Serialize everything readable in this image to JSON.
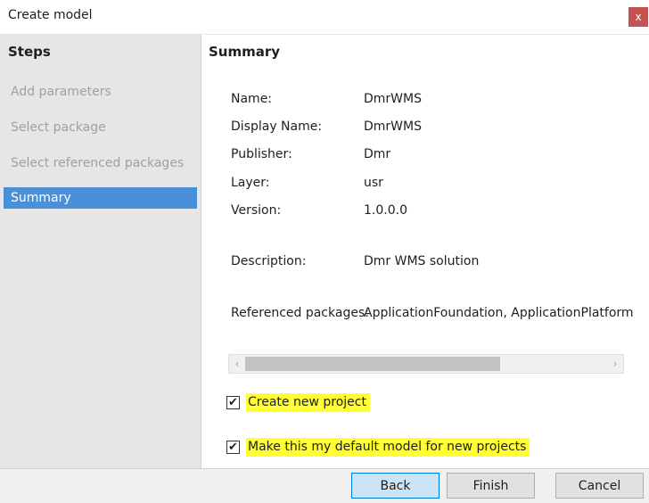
{
  "window": {
    "title": "Create model",
    "close_glyph": "x",
    "close_color": "#c75050"
  },
  "sidebar": {
    "heading": "Steps",
    "steps": [
      {
        "label": "Add parameters",
        "active": false
      },
      {
        "label": "Select package",
        "active": false
      },
      {
        "label": "Select referenced packages",
        "active": false
      },
      {
        "label": "Summary",
        "active": true
      }
    ],
    "active_color": "#4a90d9"
  },
  "summary": {
    "heading": "Summary",
    "fields": [
      {
        "label": "Name:",
        "value": "DmrWMS"
      },
      {
        "label": "Display Name:",
        "value": "DmrWMS"
      },
      {
        "label": "Publisher:",
        "value": "Dmr"
      },
      {
        "label": "Layer:",
        "value": "usr"
      },
      {
        "label": "Version:",
        "value": "1.0.0.0"
      },
      {
        "label": "Description:",
        "value": "Dmr WMS solution"
      },
      {
        "label": "Referenced packages:",
        "value": "ApplicationFoundation, ApplicationPlatform"
      }
    ],
    "scrollbar": {
      "left_arrow_glyph": "‹",
      "right_arrow_glyph": "›"
    }
  },
  "options": {
    "create_new_project": {
      "label": "Create new project",
      "checked": true
    },
    "default_model": {
      "label": "Make this my default model for new projects",
      "checked": true
    },
    "check_glyph": "✔",
    "highlight_color": "#ffff33"
  },
  "buttons": {
    "back": "Back",
    "finish": "Finish",
    "cancel": "Cancel"
  }
}
